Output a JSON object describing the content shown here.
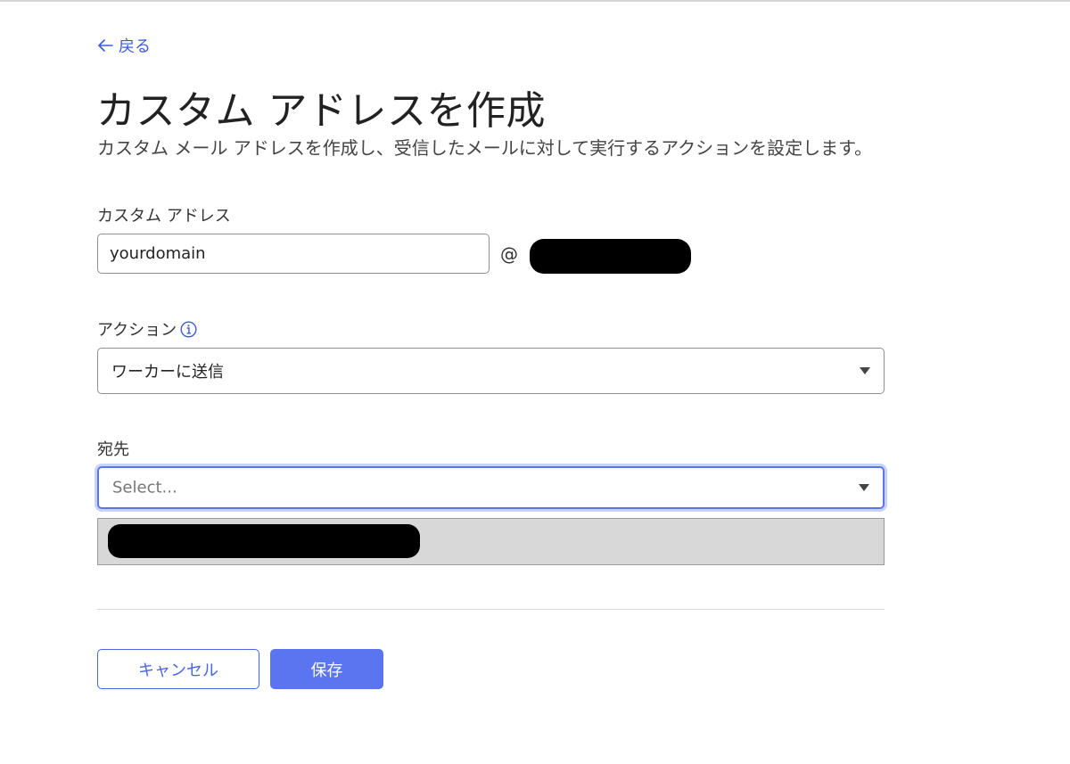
{
  "nav": {
    "back_label": "戻る"
  },
  "header": {
    "title": "カスタム アドレスを作成",
    "subtitle": "カスタム メール アドレスを作成し、受信したメールに対して実行するアクションを設定します。"
  },
  "custom_address": {
    "label": "カスタム アドレス",
    "value": "yourdomain",
    "at_symbol": "@"
  },
  "action": {
    "label": "アクション",
    "info_icon": "info-circle-icon",
    "selected": "ワーカーに送信"
  },
  "destination": {
    "label": "宛先",
    "placeholder": "Select..."
  },
  "buttons": {
    "cancel_label": "キャンセル",
    "save_label": "保存"
  },
  "colors": {
    "accent": "#5b75f0",
    "link": "#3b5bdb",
    "focus_ring": "#c9d3fb",
    "option_bg": "#d8d8d8"
  }
}
